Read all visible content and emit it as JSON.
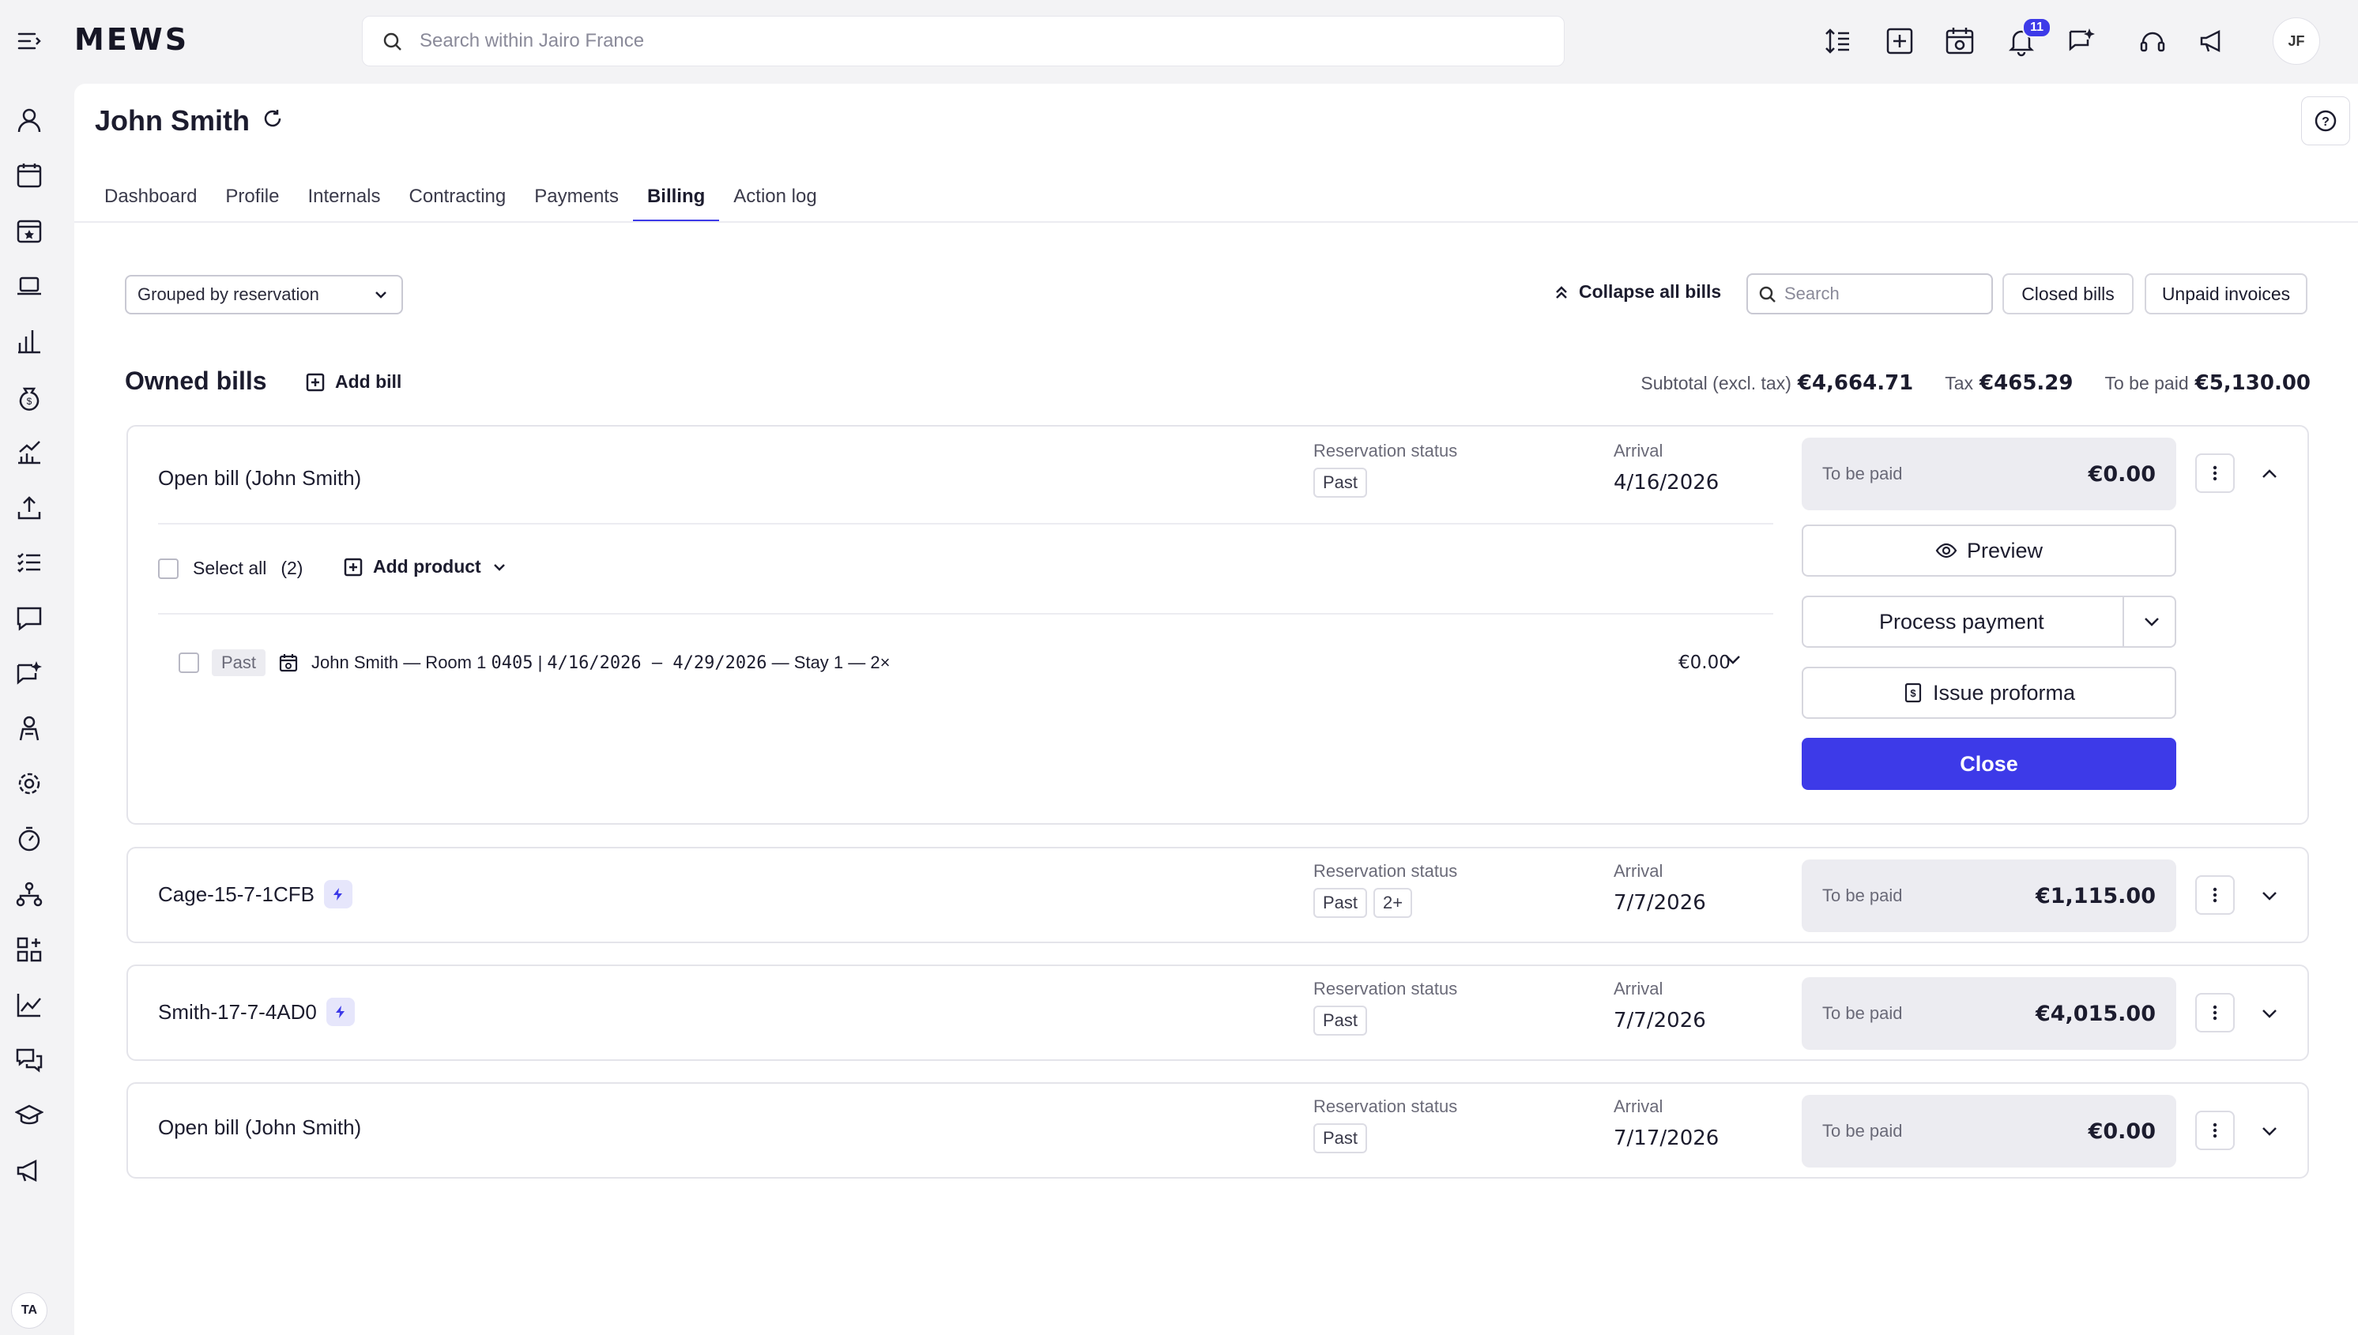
{
  "topbar": {
    "logo": "MEWS",
    "search_placeholder": "Search within Jairo France",
    "notifications_count": "11",
    "user_initials": "JF"
  },
  "sidebar": {
    "icons": [
      "person-icon",
      "calendar-icon",
      "calendar-star-icon",
      "laptop-icon",
      "bar-chart-icon",
      "money-bag-icon",
      "growth-chart-icon",
      "upload-icon",
      "checklist-icon",
      "message-icon",
      "ai-sparkle-icon",
      "housekeeper-icon",
      "settings-icon",
      "timer-icon",
      "network-icon",
      "apps-icon",
      "line-chart-icon",
      "chat-icon",
      "graduation-icon",
      "megaphone-icon"
    ],
    "user_initials": "TA"
  },
  "page": {
    "title": "John Smith",
    "tabs": [
      {
        "label": "Dashboard",
        "active": false
      },
      {
        "label": "Profile",
        "active": false
      },
      {
        "label": "Internals",
        "active": false
      },
      {
        "label": "Contracting",
        "active": false
      },
      {
        "label": "Payments",
        "active": false
      },
      {
        "label": "Billing",
        "active": true
      },
      {
        "label": "Action log",
        "active": false
      }
    ]
  },
  "toolbar": {
    "grouping": "Grouped by reservation",
    "collapse_label": "Collapse all bills",
    "search_placeholder": "Search",
    "closed_bills": "Closed bills",
    "unpaid_invoices": "Unpaid invoices"
  },
  "owned": {
    "title": "Owned bills",
    "add_bill": "Add bill",
    "subtotal_label": "Subtotal (excl. tax)",
    "subtotal_value": "€4,664.71",
    "tax_label": "Tax",
    "tax_value": "€465.29",
    "topay_label": "To be paid",
    "topay_value": "€5,130.00"
  },
  "labels": {
    "reservation_status": "Reservation status",
    "arrival": "Arrival",
    "to_be_paid": "To be paid"
  },
  "bills": [
    {
      "name": "Open bill (John Smith)",
      "status": [
        "Past"
      ],
      "arrival": "4/16/2026",
      "to_be_paid": "€0.00",
      "expanded": true
    },
    {
      "name": "Cage-15-7-1CFB",
      "status": [
        "Past",
        "2+"
      ],
      "arrival": "7/7/2026",
      "to_be_paid": "€1,115.00",
      "expanded": false,
      "bolt": true
    },
    {
      "name": "Smith-17-7-4AD0",
      "status": [
        "Past"
      ],
      "arrival": "7/7/2026",
      "to_be_paid": "€4,015.00",
      "expanded": false,
      "bolt": true
    },
    {
      "name": "Open bill (John Smith)",
      "status": [
        "Past"
      ],
      "arrival": "7/17/2026",
      "to_be_paid": "€0.00",
      "expanded": false
    }
  ],
  "expanded": {
    "select_all": "Select all",
    "select_count": "(2)",
    "add_product": "Add product",
    "item_status": "Past",
    "item_text_a": "John Smith — Room 1 ",
    "item_room": "0405",
    "item_text_b": " | ",
    "item_dates": "4/16/2026 — 4/29/2026",
    "item_text_c": " — Stay 1 — 2×",
    "item_value": "€0.00",
    "preview": "Preview",
    "process_payment": "Process payment",
    "issue_proforma": "Issue proforma",
    "close": "Close"
  }
}
